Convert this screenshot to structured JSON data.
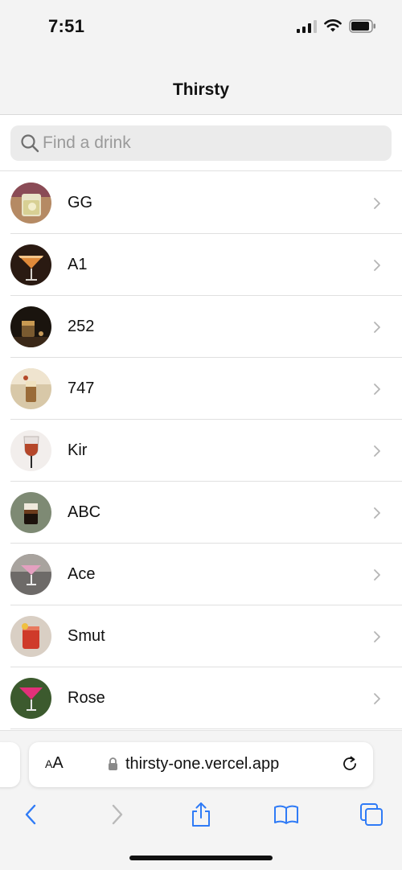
{
  "status_bar": {
    "time": "7:51"
  },
  "nav": {
    "title": "Thirsty"
  },
  "search": {
    "placeholder": "Find a drink",
    "value": ""
  },
  "drinks": [
    {
      "name": "GG",
      "icon": "drink-photo-gg"
    },
    {
      "name": "A1",
      "icon": "drink-photo-a1"
    },
    {
      "name": "252",
      "icon": "drink-photo-252"
    },
    {
      "name": "747",
      "icon": "drink-photo-747"
    },
    {
      "name": "Kir",
      "icon": "drink-photo-kir"
    },
    {
      "name": "ABC",
      "icon": "drink-photo-abc"
    },
    {
      "name": "Ace",
      "icon": "drink-photo-ace"
    },
    {
      "name": "Smut",
      "icon": "drink-photo-smut"
    },
    {
      "name": "Rose",
      "icon": "drink-photo-rose"
    }
  ],
  "browser": {
    "text_size_label_small": "A",
    "text_size_label_large": "A",
    "url": "thirsty-one.vercel.app"
  },
  "colors": {
    "accent": "#2f7bf6",
    "disabled": "#b9b9b9"
  }
}
